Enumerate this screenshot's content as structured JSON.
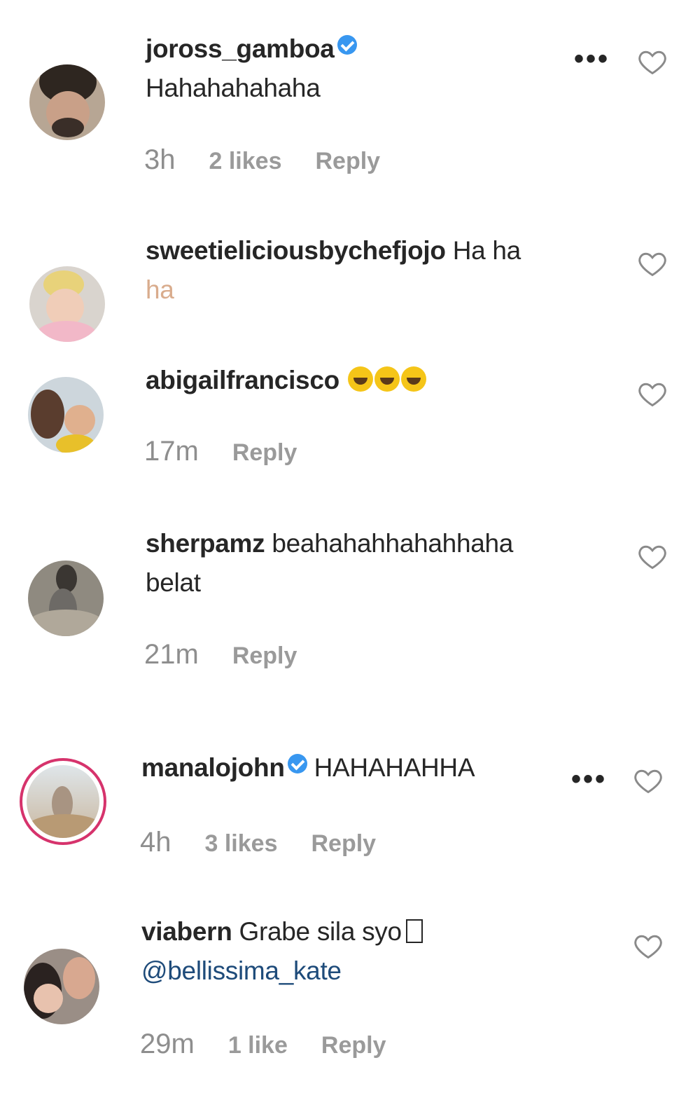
{
  "comments": [
    {
      "username": "joross_gamboa",
      "verified": true,
      "text": "Hahahahahaha",
      "time": "3h",
      "likes": "2 likes",
      "reply": "Reply",
      "has_more": true,
      "more_label": "•••"
    },
    {
      "username": "sweetieliciousbychefjojo",
      "verified": false,
      "text": "Ha ha",
      "text_line2": "ha",
      "time": "",
      "likes": "",
      "reply": "",
      "has_more": false
    },
    {
      "username": "abigailfrancisco",
      "verified": false,
      "text": "",
      "emoji_count": 3,
      "time": "17m",
      "likes": "",
      "reply": "Reply",
      "has_more": false
    },
    {
      "username": "sherpamz",
      "verified": false,
      "text": "beahahahhahahhaha",
      "text_line2": "belat",
      "time": "21m",
      "likes": "",
      "reply": "Reply",
      "has_more": false
    },
    {
      "username": "manalojohn",
      "verified": true,
      "text": "HAHAHAHHA",
      "time": "4h",
      "likes": "3 likes",
      "reply": "Reply",
      "has_more": true,
      "more_label": "•••"
    },
    {
      "username": "viabern",
      "verified": false,
      "text": "Grabe sila syo",
      "mention": "@bellissima_kate",
      "time": "29m",
      "likes": "1 like",
      "reply": "Reply",
      "has_more": false
    }
  ],
  "icons": {
    "heart": "heart-outline-icon",
    "verified": "verified-badge-icon",
    "more": "more-options-icon"
  },
  "colors": {
    "verified_blue": "#3897f0",
    "story_ring": "#d6336c",
    "meta_gray": "#8e8e8e",
    "mention_blue": "#1e4b7a"
  }
}
